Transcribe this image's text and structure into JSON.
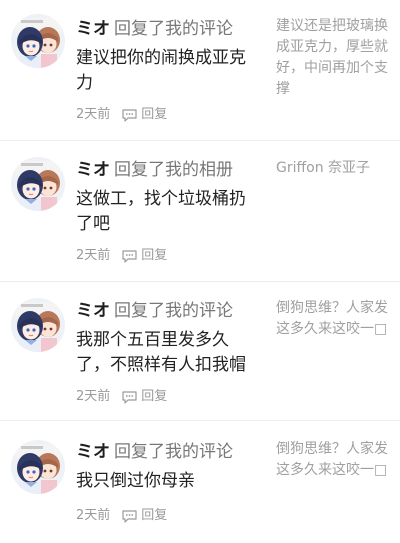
{
  "notifications": [
    {
      "username": "ミオ",
      "action": "回复了我的评论",
      "body": "建议把你的闹换成亚克力",
      "time": "2天前",
      "reply_label": "回复",
      "quote": "建议还是把玻璃换成亚克力，厚些就好，中间再加个支撑"
    },
    {
      "username": "ミオ",
      "action": "回复了我的相册",
      "body": "这做工，找个垃圾桶扔了吧",
      "time": "2天前",
      "reply_label": "回复",
      "quote": "Griffon 奈亚子"
    },
    {
      "username": "ミオ",
      "action": "回复了我的评论",
      "body": "我那个五百里发多久了，不照样有人扣我帽",
      "time": "2天前",
      "reply_label": "回复",
      "quote": "倒狗思维？人家发这多久来这咬一□"
    },
    {
      "username": "ミオ",
      "action": "回复了我的评论",
      "body": "我只倒过你母亲",
      "time": "2天前",
      "reply_label": "回复",
      "quote": "倒狗思维？人家发这多久来这咬一□"
    }
  ],
  "icons": {
    "reply": "comment-bubble-icon",
    "avatar": "anime-girls-avatar"
  },
  "colors": {
    "username": "#1e1e1e",
    "secondary": "#777777",
    "muted": "#9a9a9a",
    "divider": "#ededed"
  }
}
